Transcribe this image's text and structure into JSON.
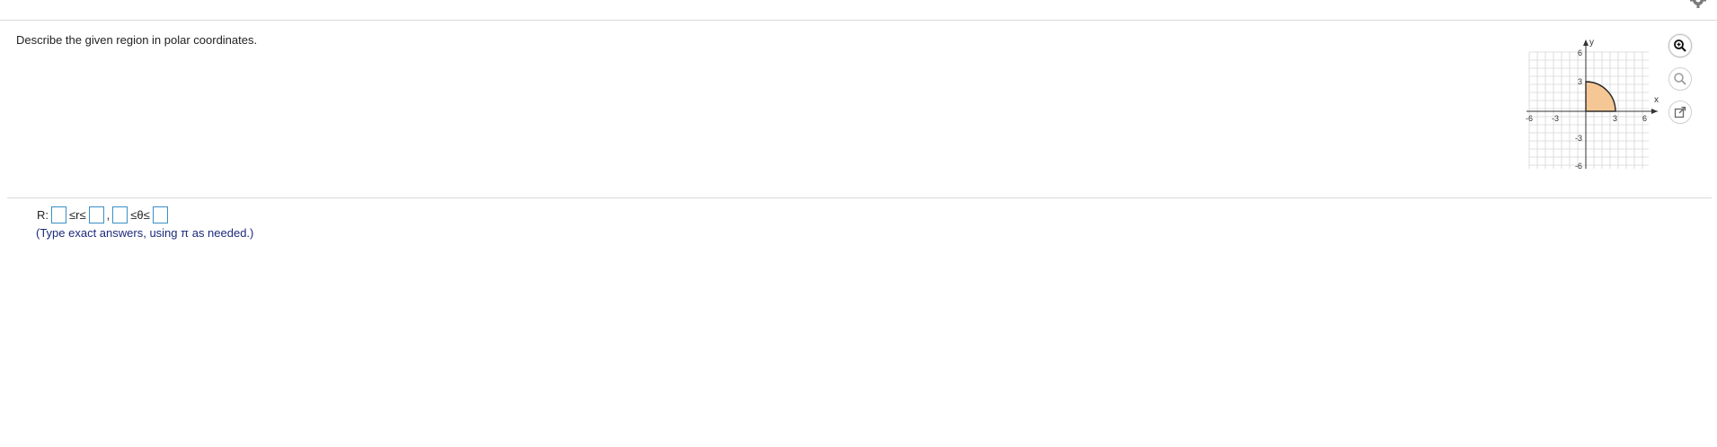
{
  "question": {
    "prompt": "Describe the given region in polar coordinates."
  },
  "graph": {
    "x_axis_label": "x",
    "y_axis_label": "y",
    "x_ticks": [
      "-6",
      "-3",
      "3",
      "6"
    ],
    "y_ticks": [
      "6",
      "3",
      "-3",
      "-6"
    ],
    "region_fill_color": "#f5c795",
    "region_description": "quarter disk of radius 3 in first quadrant"
  },
  "tools": {
    "zoom_in_icon": "zoom-in-icon",
    "zoom_out_icon": "zoom-out-icon",
    "popout_icon": "popout-icon"
  },
  "answer": {
    "prefix": "R:",
    "sym_r": "≤r≤",
    "comma": ",",
    "sym_theta": "≤θ≤",
    "hint": "(Type exact answers, using π as needed.)"
  },
  "colors": {
    "input_border": "#3a8fc7",
    "hint_text": "#1c2a7c"
  }
}
